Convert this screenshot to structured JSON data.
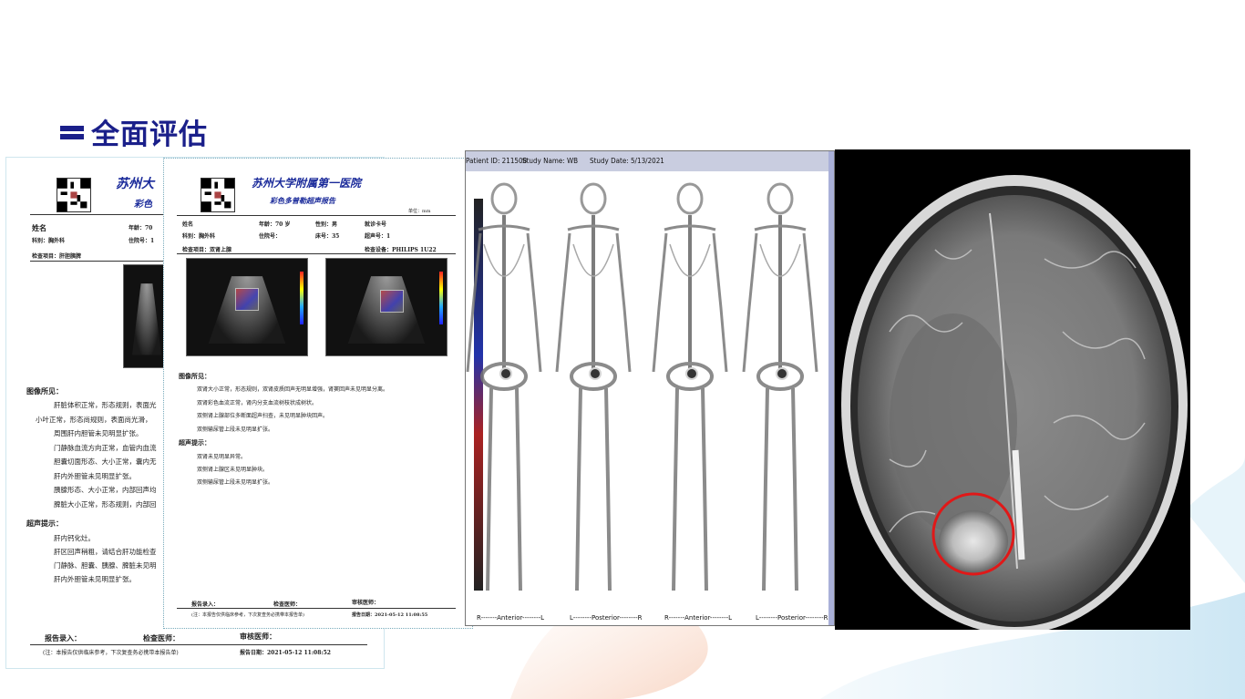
{
  "slide": {
    "title": "全面评估",
    "colors": {
      "title": "#1a1f8a",
      "highlight_circle": "#e01818"
    }
  },
  "report_back": {
    "hospital": "苏州大",
    "subtitle": "彩色",
    "name_label": "姓名",
    "age_label": "年龄：70",
    "dept_label": "科别：胸外科",
    "admission_label": "住院号：1",
    "exam_item": "检查项目：肝胆胰脾",
    "findings_title": "图像所见：",
    "findings": [
      "肝脏体积正常，形态规则，表面光",
      "小叶正常，形态尚规则，表面尚光滑，",
      "周围肝内胆管未见明显扩张。",
      "门静脉血流方向正常，血管内血流",
      "胆囊切面形态、大小正常，囊内无",
      "肝内外胆管未见明显扩张。",
      "胰腺形态、大小正常，内部回声均",
      "脾脏大小正常，形态规则，内部回"
    ],
    "hint_title": "超声提示：",
    "hints": [
      "肝内钙化灶。",
      "肝区回声稍粗，请结合肝功能检查",
      "门静脉、胆囊、胰腺、脾脏未见明",
      "肝内外胆管未见明显扩张。"
    ],
    "report_entry": "报告录入：",
    "exam_doctor": "检查医师：",
    "review_doctor": "审核医师：",
    "note": "(注：本报告仅供临床参考，下次复查务必携带本报告单)",
    "report_date": "报告日期：2021-05-12 11:08:52"
  },
  "report_front": {
    "hospital": "苏州大学附属第一医院",
    "subtitle": "彩色多普勒超声报告",
    "unit_label": "单位：mm",
    "name_label": "姓名",
    "age_label": "年龄：70 岁",
    "sex_label": "性别：男",
    "card_label": "就诊卡号",
    "dept_label": "科别：胸外科",
    "admission_label": "住院号：",
    "bed_label": "床号：35",
    "us_no_label": "超声号：1",
    "exam_item": "检查项目：双肾上腺",
    "device_label": "检查设备：PHILIPS 1U22",
    "findings_title": "图像所见：",
    "findings": [
      "双肾大小正常，形态规则，双肾皮质回声无明显增强，肾窦回声未见明显分离。",
      "双肾彩色血流正常，肾内分支血流树枝状成树状。",
      "双侧肾上腺部位多断面超声扫查，未见明显肿块回声。",
      "双侧输尿管上段未见明显扩张。"
    ],
    "hint_title": "超声提示：",
    "hints": [
      "双肾未见明显异常。",
      "双侧肾上腺区未见明显肿块。",
      "双侧输尿管上段未见明显扩张。"
    ],
    "report_entry": "报告录入：",
    "exam_doctor": "检查医师：",
    "review_doctor": "审核医师：",
    "note": "(注：本报告仅供临床参考，下次复查务必携带本报告单)",
    "report_date": "报告日期：2021-05-12 11:08:55"
  },
  "bone_scan": {
    "patient_id": "Patient ID: 211508",
    "study_name": "Study Name: WB",
    "study_date": "Study Date: 5/13/2021",
    "footers": [
      "R-------Anterior--------L",
      "L--------Posterior--------R",
      "R-------Anterior--------L",
      "L--------Posterior--------R"
    ]
  },
  "mri": {
    "annotation_icon": "red-circle-lesion-marker"
  }
}
